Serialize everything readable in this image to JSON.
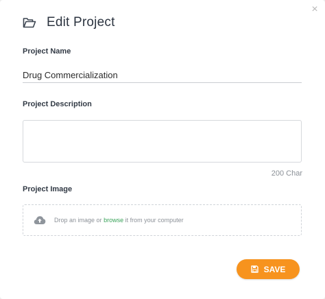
{
  "dialog": {
    "title": "Edit Project",
    "close_symbol": "×"
  },
  "project_name": {
    "label": "Project Name",
    "value": "Drug Commercialization"
  },
  "project_description": {
    "label": "Project Description",
    "value": "",
    "char_counter": "200 Char"
  },
  "project_image": {
    "label": "Project Image",
    "drop_text_before": "Drop an image or",
    "browse_link": "browse",
    "drop_text_after": "it from your computer"
  },
  "actions": {
    "save_label": "SAVE"
  },
  "icons": {
    "header": "folder-open-icon",
    "upload": "cloud-upload-icon",
    "save": "floppy-disk-icon",
    "close": "close-icon"
  },
  "colors": {
    "accent": "#f7931e",
    "link": "#3aa35a",
    "text_dark": "#2c3440"
  }
}
